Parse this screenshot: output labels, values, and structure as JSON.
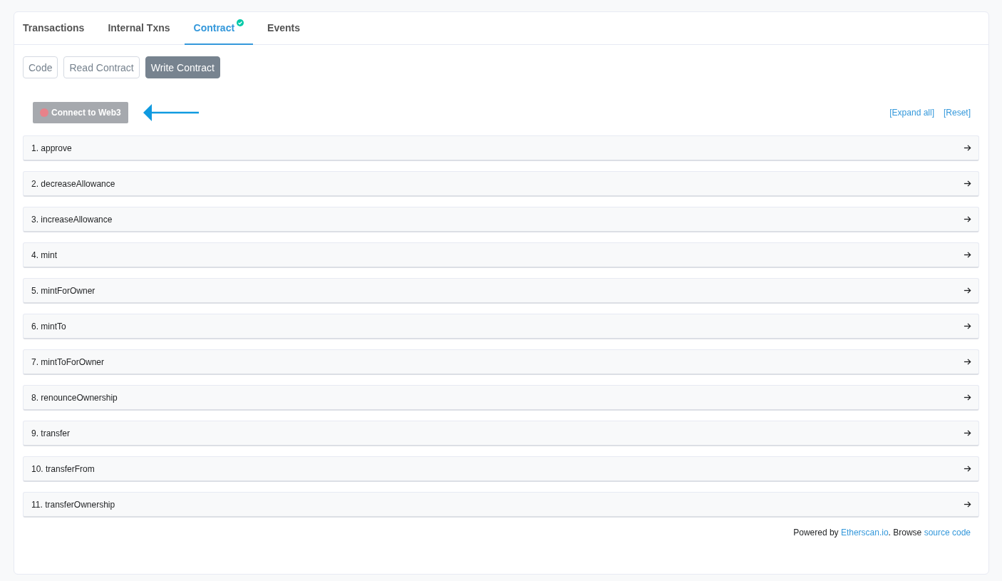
{
  "tabs": [
    {
      "label": "Transactions",
      "selected": false,
      "verified": false
    },
    {
      "label": "Internal Txns",
      "selected": false,
      "verified": false
    },
    {
      "label": "Contract",
      "selected": true,
      "verified": true
    },
    {
      "label": "Events",
      "selected": false,
      "verified": false
    }
  ],
  "subtabs": [
    {
      "label": "Code",
      "selected": false
    },
    {
      "label": "Read Contract",
      "selected": false
    },
    {
      "label": "Write Contract",
      "selected": true
    }
  ],
  "connect_button": {
    "label": "Connect to Web3",
    "connected": false
  },
  "links": [
    "[Expand all]",
    "[Reset]"
  ],
  "functions": [
    {
      "label": "1. approve"
    },
    {
      "label": "2. decreaseAllowance"
    },
    {
      "label": "3. increaseAllowance"
    },
    {
      "label": "4. mint"
    },
    {
      "label": "5. mintForOwner"
    },
    {
      "label": "6. mintTo"
    },
    {
      "label": "7. mintToForOwner"
    },
    {
      "label": "8. renounceOwnership"
    },
    {
      "label": "9. transfer"
    },
    {
      "label": "10. transferFrom"
    },
    {
      "label": "11. transferOwnership"
    }
  ],
  "footer": {
    "text_1": "Powered by ",
    "link_1": "Etherscan.io",
    "text_2": ". Browse ",
    "link_2": "source code"
  }
}
